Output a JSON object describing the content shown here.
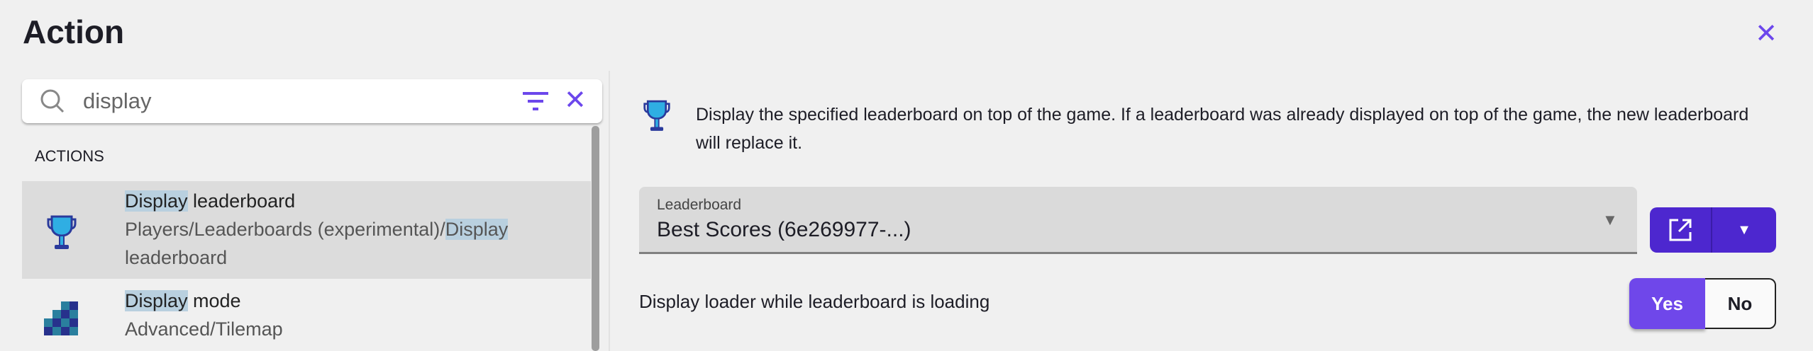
{
  "header": {
    "title": "Action",
    "close_icon": "close-icon"
  },
  "search": {
    "value": "display",
    "icons": [
      "search-icon",
      "filter-icon",
      "clear-icon"
    ]
  },
  "list": {
    "section_label": "ACTIONS",
    "items": [
      {
        "highlight": "Display",
        "name_rest": " leaderboard",
        "path_prefix": "Players/Leaderboards (experimental)/",
        "path_highlight": "Display",
        "path_rest": "leaderboard",
        "icon": "trophy-icon",
        "selected": true
      },
      {
        "highlight": "Display",
        "name_rest": " mode",
        "path": "Advanced/Tilemap",
        "icon": "tilemap-icon",
        "selected": false
      }
    ]
  },
  "detail": {
    "description": "Display the specified leaderboard on top of the game. If a leaderboard was already displayed on top of the game, the new leaderboard will replace it.",
    "leaderboard_label": "Leaderboard",
    "leaderboard_value": "Best Scores (6e269977-...)",
    "toggle_label": "Display loader while leaderboard is loading",
    "yes": "Yes",
    "no": "No",
    "toggle_value": "Yes"
  },
  "colors": {
    "accent": "#6c47ec",
    "button": "#4d27cf",
    "highlight": "#b9d0df"
  }
}
